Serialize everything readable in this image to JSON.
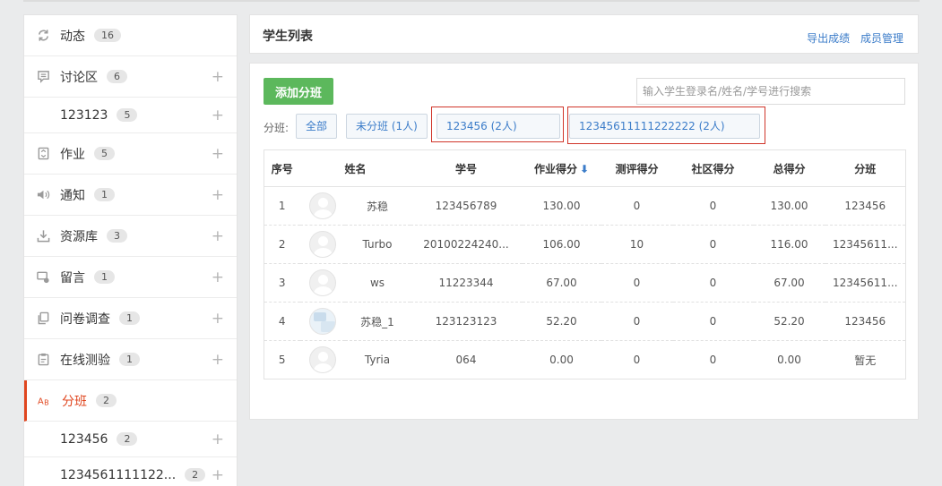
{
  "sidebar": {
    "items": [
      {
        "label": "动态",
        "count": "16",
        "icon": "refresh-icon",
        "plus": false
      },
      {
        "label": "讨论区",
        "count": "6",
        "icon": "comment-icon",
        "plus": true
      },
      {
        "label": "123123",
        "count": "5",
        "sub": true,
        "plus": true
      },
      {
        "label": "作业",
        "count": "5",
        "icon": "homework-icon",
        "plus": true
      },
      {
        "label": "通知",
        "count": "1",
        "icon": "megaphone-icon",
        "plus": true
      },
      {
        "label": "资源库",
        "count": "3",
        "icon": "download-icon",
        "plus": true
      },
      {
        "label": "留言",
        "count": "1",
        "icon": "message-icon",
        "plus": true
      },
      {
        "label": "问卷调查",
        "count": "1",
        "icon": "survey-icon",
        "plus": true
      },
      {
        "label": "在线测验",
        "count": "1",
        "icon": "quiz-icon",
        "plus": true
      },
      {
        "label": "分班",
        "count": "2",
        "icon": "group-icon",
        "active": true,
        "plus": false
      },
      {
        "label": "123456",
        "count": "2",
        "sub": true,
        "plus": true
      },
      {
        "label": "1234561111122...",
        "count": "2",
        "sub": true,
        "plus": true
      }
    ],
    "plus_symbol": "+"
  },
  "header": {
    "title": "学生列表",
    "export_label": "导出成绩",
    "members_label": "成员管理"
  },
  "toolbar": {
    "add_label": "添加分班",
    "search_placeholder": "输入学生登录名/姓名/学号进行搜索"
  },
  "classes": {
    "label": "分班:",
    "all": "全部",
    "unassigned": "未分班 (1人)",
    "class1": "123456 (2人)",
    "class2": "12345611111222222 (2人)"
  },
  "table": {
    "headers": [
      "序号",
      "姓名",
      "学号",
      "作业得分",
      "测评得分",
      "社区得分",
      "总得分",
      "分班"
    ],
    "sort_arrow": "⬇",
    "rows": [
      {
        "no": "1",
        "name": "苏稳",
        "id": "123456789",
        "hw": "130.00",
        "eval": "0",
        "community": "0",
        "total": "130.00",
        "cls": "123456",
        "avatar": "default"
      },
      {
        "no": "2",
        "name": "Turbo",
        "id": "20100224240...",
        "hw": "106.00",
        "eval": "10",
        "community": "0",
        "total": "116.00",
        "cls": "12345611...",
        "avatar": "default"
      },
      {
        "no": "3",
        "name": "ws",
        "id": "11223344",
        "hw": "67.00",
        "eval": "0",
        "community": "0",
        "total": "67.00",
        "cls": "12345611...",
        "avatar": "default"
      },
      {
        "no": "4",
        "name": "苏稳_1",
        "id": "123123123",
        "hw": "52.20",
        "eval": "0",
        "community": "0",
        "total": "52.20",
        "cls": "123456",
        "avatar": "photo"
      },
      {
        "no": "5",
        "name": "Tyria",
        "id": "064",
        "hw": "0.00",
        "eval": "0",
        "community": "0",
        "total": "0.00",
        "cls": "暂无",
        "avatar": "default"
      }
    ]
  },
  "colors": {
    "accent_green": "#5cb85c",
    "link_blue": "#3b7cc9",
    "active_red": "#e0461f",
    "highlight_red": "#d0352a"
  }
}
